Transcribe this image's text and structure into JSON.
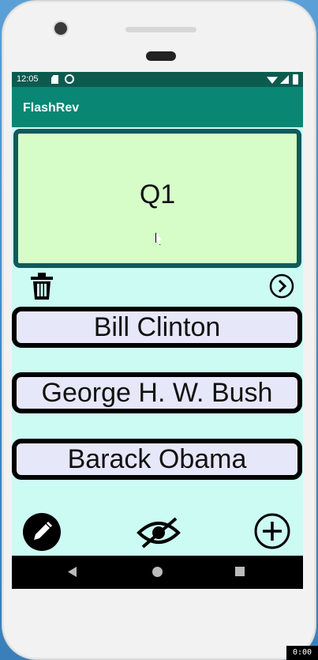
{
  "statusbar": {
    "time": "12:05"
  },
  "appbar": {
    "title": "FlashRev"
  },
  "question": {
    "label": "Q1"
  },
  "answers": [
    "Bill Clinton",
    "George H. W. Bush",
    "Barack Obama"
  ],
  "icons": {
    "delete": "trash-icon",
    "next": "chevron-right-circle-icon",
    "edit": "pencil-icon",
    "toggle_visibility": "eye-off-icon",
    "add": "plus-circle-icon"
  },
  "overlay": {
    "recording_time": "0:00"
  },
  "colors": {
    "appbar": "#0a8675",
    "statusbar": "#0d5b4f",
    "screen_bg": "#ccfbf4",
    "question_card": "#d6fcc8",
    "question_border": "#0f5a5c",
    "answer_bg": "#e7e7fa"
  }
}
